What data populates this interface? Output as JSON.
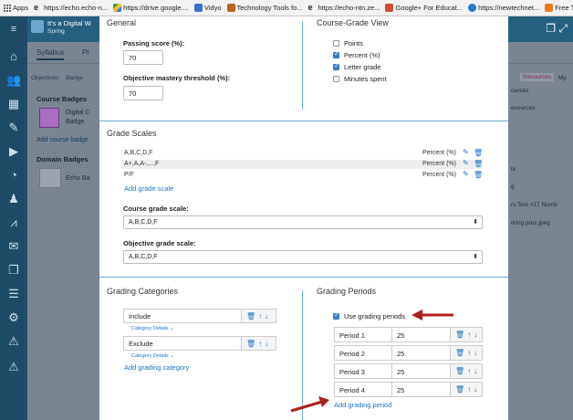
{
  "bookmarks": [
    {
      "label": "Apps",
      "icon": "apps-grid-icon",
      "color": "#666666"
    },
    {
      "label": "https://echo.echo-n...",
      "icon": "echo-e-icon",
      "color": "#222222"
    },
    {
      "label": "https://drive.google....",
      "icon": "google-drive-icon",
      "color": "#2aa34a"
    },
    {
      "label": "Vidyo",
      "icon": "vidyo-icon",
      "color": "#3d6fd1"
    },
    {
      "label": "Technology Tools fo...",
      "icon": "tools-icon",
      "color": "#b5651d"
    },
    {
      "label": "https://echo-ntn.ze...",
      "icon": "echo-e-icon",
      "color": "#222222"
    },
    {
      "label": "Google+ For Educat...",
      "icon": "google-plus-icon",
      "color": "#d44b3a"
    },
    {
      "label": "https://newtechnet...",
      "icon": "newtech-icon",
      "color": "#2b7ac2"
    },
    {
      "label": "Free Technology for...",
      "icon": "blogger-icon",
      "color": "#f07a1a"
    }
  ],
  "background": {
    "course_title": "It's a Digital W",
    "course_term": "Spring",
    "subtabs": [
      "Syllabus",
      "Pl"
    ],
    "left_tabs": [
      "Objectives",
      "Badge"
    ],
    "course_badges_heading": "Course Badges",
    "badge_name_line1": "Digital C",
    "badge_name_line2": "Badge",
    "add_course_badge": "Add course badge",
    "domain_badges_heading": "Domain Badges",
    "domain_badge_name": "Echo Ba",
    "right_items": [
      "Resources",
      "My",
      "ources",
      "esources",
      "tx",
      "g",
      "rs Test #17 Numb",
      "rking prez.jpeg"
    ]
  },
  "general": {
    "title": "General",
    "passing_score_label": "Passing score (%):",
    "passing_score_value": "70",
    "mastery_label": "Objective mastery threshold (%):",
    "mastery_value": "70"
  },
  "course_grade_view": {
    "title": "Course-Grade View",
    "options": [
      {
        "label": "Points",
        "checked": false
      },
      {
        "label": "Percent (%)",
        "checked": true
      },
      {
        "label": "Letter grade",
        "checked": true
      },
      {
        "label": "Minutes spent",
        "checked": false
      }
    ]
  },
  "grade_scales": {
    "title": "Grade Scales",
    "rows": [
      {
        "name": "A,B,C,D,F",
        "type": "Percent (%)"
      },
      {
        "name": "A+,A,A-,...,F",
        "type": "Percent (%)"
      },
      {
        "name": "P/F",
        "type": "Percent (%)"
      }
    ],
    "add_link": "Add grade scale",
    "course_scale_label": "Course grade scale:",
    "course_scale_value": "A,B,C,D,F",
    "objective_scale_label": "Objective grade scale:",
    "objective_scale_value": "A,B,C,D,F"
  },
  "grading_categories": {
    "title": "Grading Categories",
    "items": [
      {
        "name": "Include",
        "details": "Category Details"
      },
      {
        "name": "Exclude",
        "details": "Category Details"
      }
    ],
    "add_link": "Add grading category"
  },
  "grading_periods": {
    "title": "Grading Periods",
    "use_label": "Use grading periods",
    "use_checked": true,
    "periods": [
      {
        "name": "Period 1",
        "value": "25"
      },
      {
        "name": "Period 2",
        "value": "25"
      },
      {
        "name": "Period 3",
        "value": "25"
      },
      {
        "name": "Period 4",
        "value": "25"
      }
    ],
    "add_link": "Add grading period"
  },
  "colors": {
    "accent": "#1a73c9",
    "annotation_arrow": "#b0201c",
    "section_divider": "#6ab0d4",
    "nav_bg": "#1f4b66"
  }
}
